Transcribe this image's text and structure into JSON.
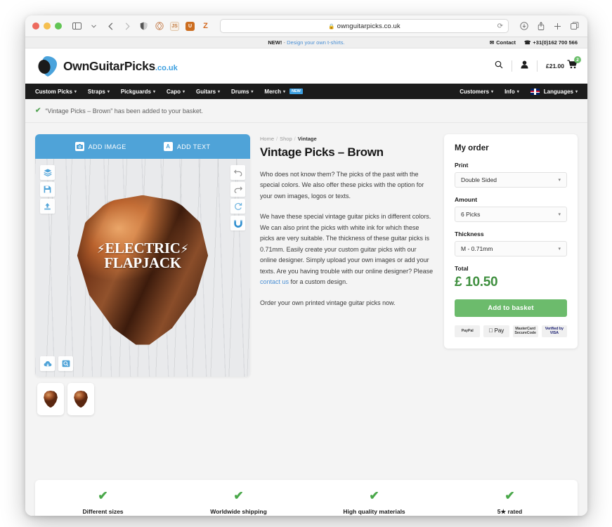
{
  "browser": {
    "url": "ownguitarpicks.co.uk",
    "lock_icon": "lock-icon",
    "reload_icon": "reload-icon",
    "extensions": [
      {
        "name": "shield-icon",
        "glyph": "◐",
        "color": "#555555",
        "bg": "transparent"
      },
      {
        "name": "ghostery-extension-icon",
        "glyph": "❀",
        "color": "#c98a5e",
        "bg": "transparent"
      },
      {
        "name": "javascript-extension-icon",
        "glyph": "JS",
        "color": "#c07a42",
        "bg": "#f7efe6"
      },
      {
        "name": "ublock-extension-icon",
        "glyph": "U",
        "color": "#ffffff",
        "bg": "#cc6d1f"
      },
      {
        "name": "zotero-extension-icon",
        "glyph": "Z",
        "color": "#d4691e",
        "bg": "transparent"
      }
    ]
  },
  "topbar": {
    "promo_prefix": "NEW!",
    "promo_link": "Design your own t-shirts.",
    "contact_label": "Contact",
    "phone": "+31(0)162 700 566"
  },
  "header": {
    "logo_name": "OwnGuitarPicks",
    "logo_tld": ".co.uk",
    "cart_total": "£21.00",
    "cart_count": "2"
  },
  "nav": {
    "left": [
      {
        "label": "Custom Picks",
        "caret": true
      },
      {
        "label": "Straps",
        "caret": true
      },
      {
        "label": "Pickguards",
        "caret": true
      },
      {
        "label": "Capo",
        "caret": true
      },
      {
        "label": "Guitars",
        "caret": true
      },
      {
        "label": "Drums",
        "caret": true
      },
      {
        "label": "Merch",
        "caret": true,
        "badge": "NEW"
      }
    ],
    "right": [
      {
        "label": "Customers",
        "caret": true
      },
      {
        "label": "Info",
        "caret": true
      },
      {
        "label": "Languages",
        "caret": true,
        "flag": true
      }
    ]
  },
  "notice": {
    "text": "“Vintage Picks – Brown” has been added to your basket."
  },
  "designer": {
    "add_image_label": "ADD IMAGE",
    "add_text_label": "ADD TEXT",
    "add_image_icon": "camera-icon",
    "add_text_icon": "text-a-icon",
    "left_tools": [
      {
        "name": "layers-icon",
        "glyph": "☲"
      },
      {
        "name": "save-icon",
        "glyph": "▣"
      },
      {
        "name": "upload-icon",
        "glyph": "↑"
      }
    ],
    "right_tools": [
      {
        "name": "undo-icon",
        "glyph": "↶"
      },
      {
        "name": "redo-icon",
        "glyph": "↷"
      },
      {
        "name": "reset-rotate-icon",
        "glyph": "↻"
      },
      {
        "name": "magnet-snap-icon",
        "glyph": "∪"
      }
    ],
    "bottom_tools": [
      {
        "name": "cloud-download-icon",
        "glyph": "☁"
      },
      {
        "name": "zoom-preview-icon",
        "glyph": "⌕"
      }
    ],
    "pick_text_line1": "ELECTRIC",
    "pick_text_line2": "FLAPJACK",
    "bolt_glyph": "⚡",
    "thumbnails": [
      "vintage-pick-brown-thumb-1",
      "vintage-pick-brown-thumb-2"
    ]
  },
  "product": {
    "breadcrumb": [
      "Home",
      "Shop",
      "Vintage"
    ],
    "title": "Vintage Picks – Brown",
    "paragraph1": "Who does not know them? The picks of the past with the special colors. We also offer these picks with the option for your own images, logos or texts.",
    "paragraph2_pre": "We have these special vintage guitar picks in different colors. We can also print the picks with white ink for which these picks are very suitable. The thickness of these guitar picks is 0.71mm. Easily create your custom guitar picks with our online designer. Simply upload your own images or add your texts. Are you having trouble with our online designer? Please ",
    "paragraph2_link": "contact us",
    "paragraph2_post": " for a custom design.",
    "paragraph3": "Order your own printed vintage guitar picks now."
  },
  "order": {
    "title": "My order",
    "print_label": "Print",
    "print_value": "Double Sided",
    "amount_label": "Amount",
    "amount_value": "6 Picks",
    "thickness_label": "Thickness",
    "thickness_value": "M - 0.71mm",
    "total_label": "Total",
    "total_value": "£ 10.50",
    "button_label": "Add to basket",
    "payments": [
      {
        "name": "paypal-logo",
        "text": "PayPal"
      },
      {
        "name": "apple-pay-logo",
        "text": " Pay"
      },
      {
        "name": "mastercard-securecode-logo",
        "text": "MasterCard SecureCode"
      },
      {
        "name": "verified-by-visa-logo",
        "text": "Verified by VISA"
      }
    ]
  },
  "benefits": [
    {
      "check": "✔",
      "label": "Different sizes"
    },
    {
      "check": "✔",
      "label": "Worldwide shipping"
    },
    {
      "check": "✔",
      "label": "High quality materials"
    },
    {
      "check": "✔",
      "label": "5★ rated"
    }
  ]
}
